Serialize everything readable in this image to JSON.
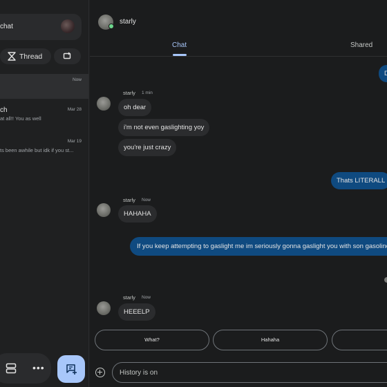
{
  "sidebar": {
    "new_chat_label": "chat",
    "thread_label": "Thread",
    "conversations": [
      {
        "name": "",
        "snippet": "",
        "date": "Now"
      },
      {
        "name": "ch",
        "snippet": "at all!! You as well",
        "date": "Mar 28"
      },
      {
        "name": "",
        "snippet": "ts been awhile but idk if you st...",
        "date": "Mar 19"
      }
    ]
  },
  "header": {
    "name": "starly"
  },
  "tabs": {
    "chat": "Chat",
    "shared": "Shared"
  },
  "messages": {
    "top_out_partial": "D",
    "group1": {
      "sender": "starly",
      "time": "1 min",
      "lines": [
        "oh dear",
        "i'm not even gaslighting yoy",
        "you're just crazy"
      ]
    },
    "out1": "Thats LITERALL",
    "group2": {
      "sender": "starly",
      "time": "Now",
      "lines": [
        "HAHAHA"
      ]
    },
    "out2": "If you keep attempting to gaslight me im seriously gonna gaslight you with son gasoline",
    "group3": {
      "sender": "starly",
      "time": "Now",
      "lines": [
        "HEEELP"
      ]
    }
  },
  "smart_replies": [
    "What?",
    "Hahaha",
    ""
  ],
  "composer": {
    "placeholder": "History is on"
  },
  "colors": {
    "accent": "#a8c7fa",
    "outgoing_bubble": "#0f4a80",
    "incoming_bubble": "#2b2c2e",
    "online": "#6dd58c"
  }
}
